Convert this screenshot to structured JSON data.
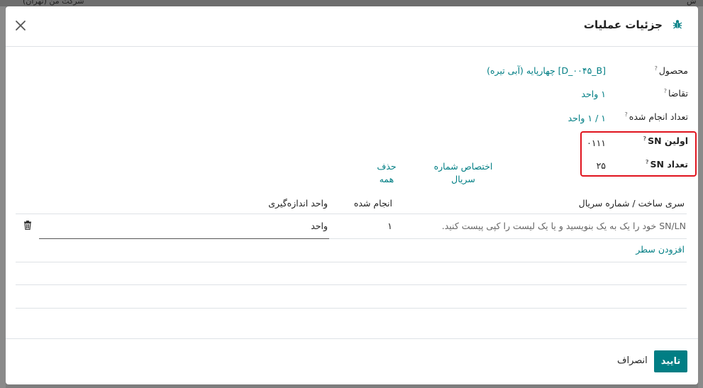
{
  "background": {
    "top_text": "شرکت من (تهران)",
    "top_text_right": "ش"
  },
  "dialog": {
    "title": "جزئیات عملیات",
    "fields": {
      "product_label": "محصول",
      "product_value": "[D_۰۰۴۵_B] چهارپایه (آبی تیره)",
      "demand_label": "تقاضا",
      "demand_value": "۱ واحد",
      "done_label": "تعداد انجام شده",
      "done_value": "۱ / ۱ واحد",
      "first_sn_label": "اولین SN",
      "first_sn_value": "۰۱۱۱",
      "sn_count_label": "تعداد SN",
      "sn_count_value": "۲۵",
      "help_mark": "?"
    },
    "actions": {
      "assign_serial_line1": "اختصاص شماره",
      "assign_serial_line2": "سریال",
      "delete_all_line1": "حذف",
      "delete_all_line2": "همه"
    },
    "table": {
      "headers": {
        "lot_serial": "سری ساخت / شماره سریال",
        "quantity_done": "انجام شده",
        "uom": "واحد اندازه‌گیری"
      },
      "rows": [
        {
          "lot_serial_placeholder": "SN/LN خود را یک به یک بنویسید و یا یک لیست را کپی پیست کنید.",
          "quantity": "۱",
          "uom": "واحد"
        }
      ],
      "add_line": "افزودن سطر"
    },
    "footer": {
      "confirm": "تایید",
      "cancel": "انصراف"
    }
  },
  "colors": {
    "accent": "#017e84",
    "highlight": "#e0141e"
  },
  "icons": {
    "close": "close-icon",
    "bug": "bug-icon",
    "trash": "trash-icon"
  }
}
